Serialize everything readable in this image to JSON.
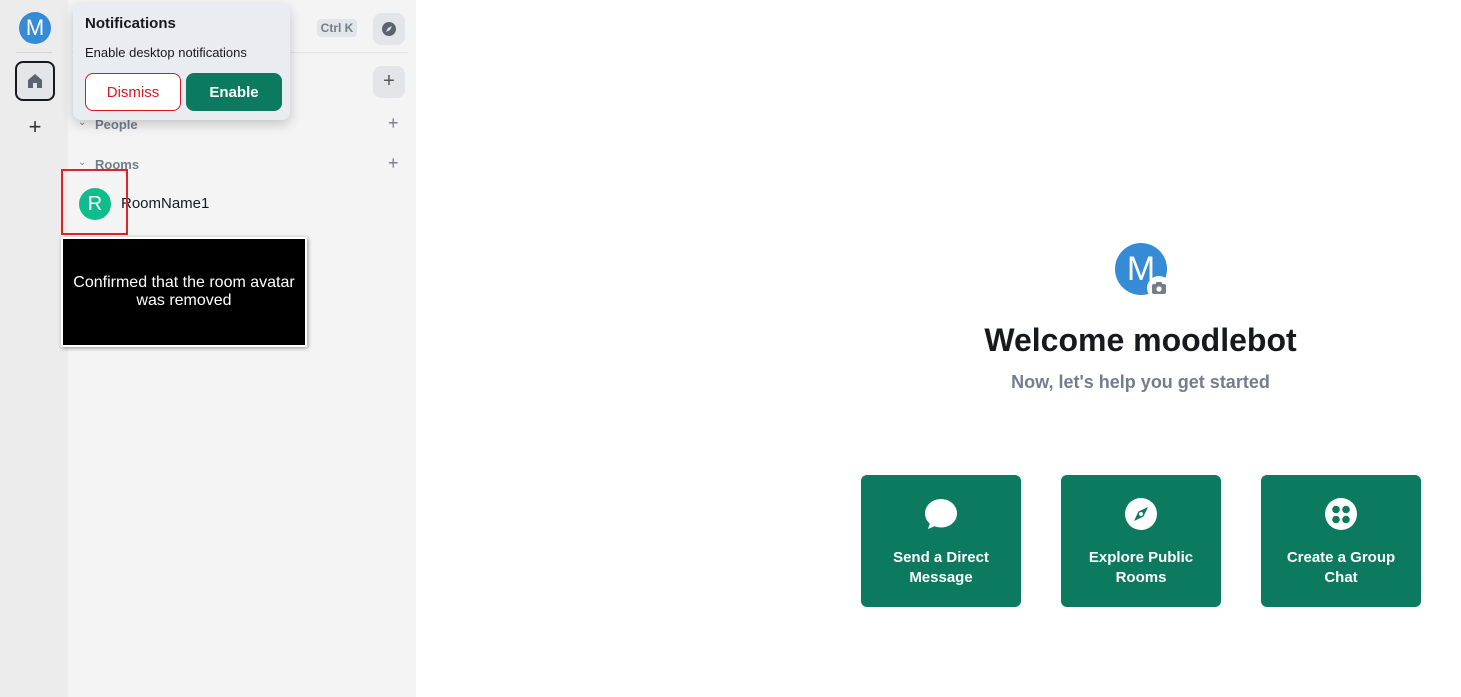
{
  "spacebar": {
    "user_initial": "M",
    "home_icon": "home-icon",
    "add_space_glyph": "+"
  },
  "roomlist": {
    "search_shortcut": "Ctrl K",
    "explore_icon": "compass-icon",
    "add_glyph": "+",
    "sections": [
      {
        "label": "People",
        "add_glyph": "+"
      },
      {
        "label": "Rooms",
        "add_glyph": "+"
      }
    ],
    "rooms": [
      {
        "initial": "R",
        "name": "RoomName1"
      }
    ]
  },
  "notification_toast": {
    "title": "Notifications",
    "description": "Enable desktop notifications",
    "dismiss_label": "Dismiss",
    "enable_label": "Enable"
  },
  "annotation": {
    "text": "Confirmed that the room avatar was removed"
  },
  "welcome": {
    "avatar_initial": "M",
    "title": "Welcome moodlebot",
    "subtitle": "Now, let's help you get started",
    "cards": [
      {
        "label": "Send a Direct Message",
        "icon": "chat-bubble-icon"
      },
      {
        "label": "Explore Public Rooms",
        "icon": "compass-icon"
      },
      {
        "label": "Create a Group Chat",
        "icon": "group-icon"
      }
    ]
  },
  "colors": {
    "accent_green": "#0b7a5f",
    "avatar_blue": "#368bd6",
    "room_avatar_green": "#0dbd8b",
    "dismiss_red": "#d51928",
    "highlight_red": "#d9262b"
  }
}
